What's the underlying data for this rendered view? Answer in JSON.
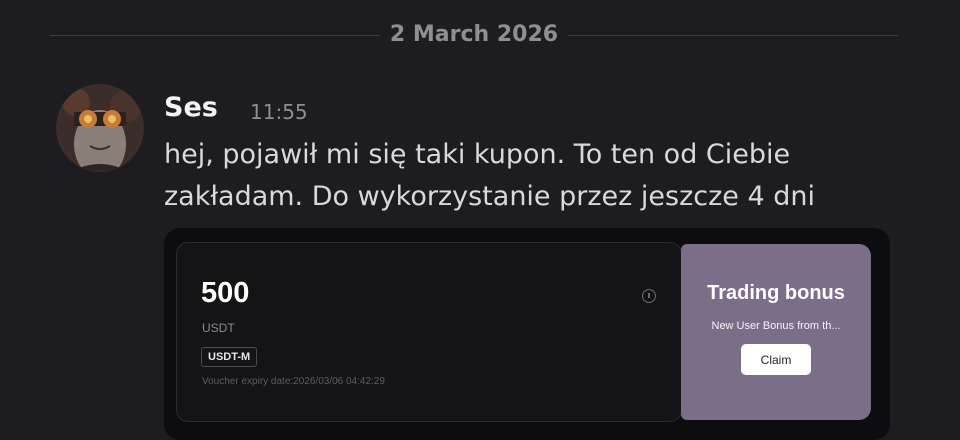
{
  "date_divider": "2 March 2026",
  "message": {
    "author": "Ses",
    "time": "11:55",
    "text_lines": [
      "hej, pojawił mi się taki kupon. To ten od Ciebie",
      "zakładam. Do wykorzystanie przez jeszcze 4 dni"
    ]
  },
  "coupon": {
    "amount": "500",
    "currency": "USDT",
    "tag": "USDT-M",
    "expiry": "Voucher expiry date:2026/03/06 04:42:29",
    "bonus_title": "Trading bonus",
    "bonus_subtitle": "New User Bonus from th...",
    "claim_label": "Claim",
    "accent_color": "#7a6e88"
  },
  "icons": {
    "avatar": "avatar-icon",
    "info": "info-icon"
  }
}
